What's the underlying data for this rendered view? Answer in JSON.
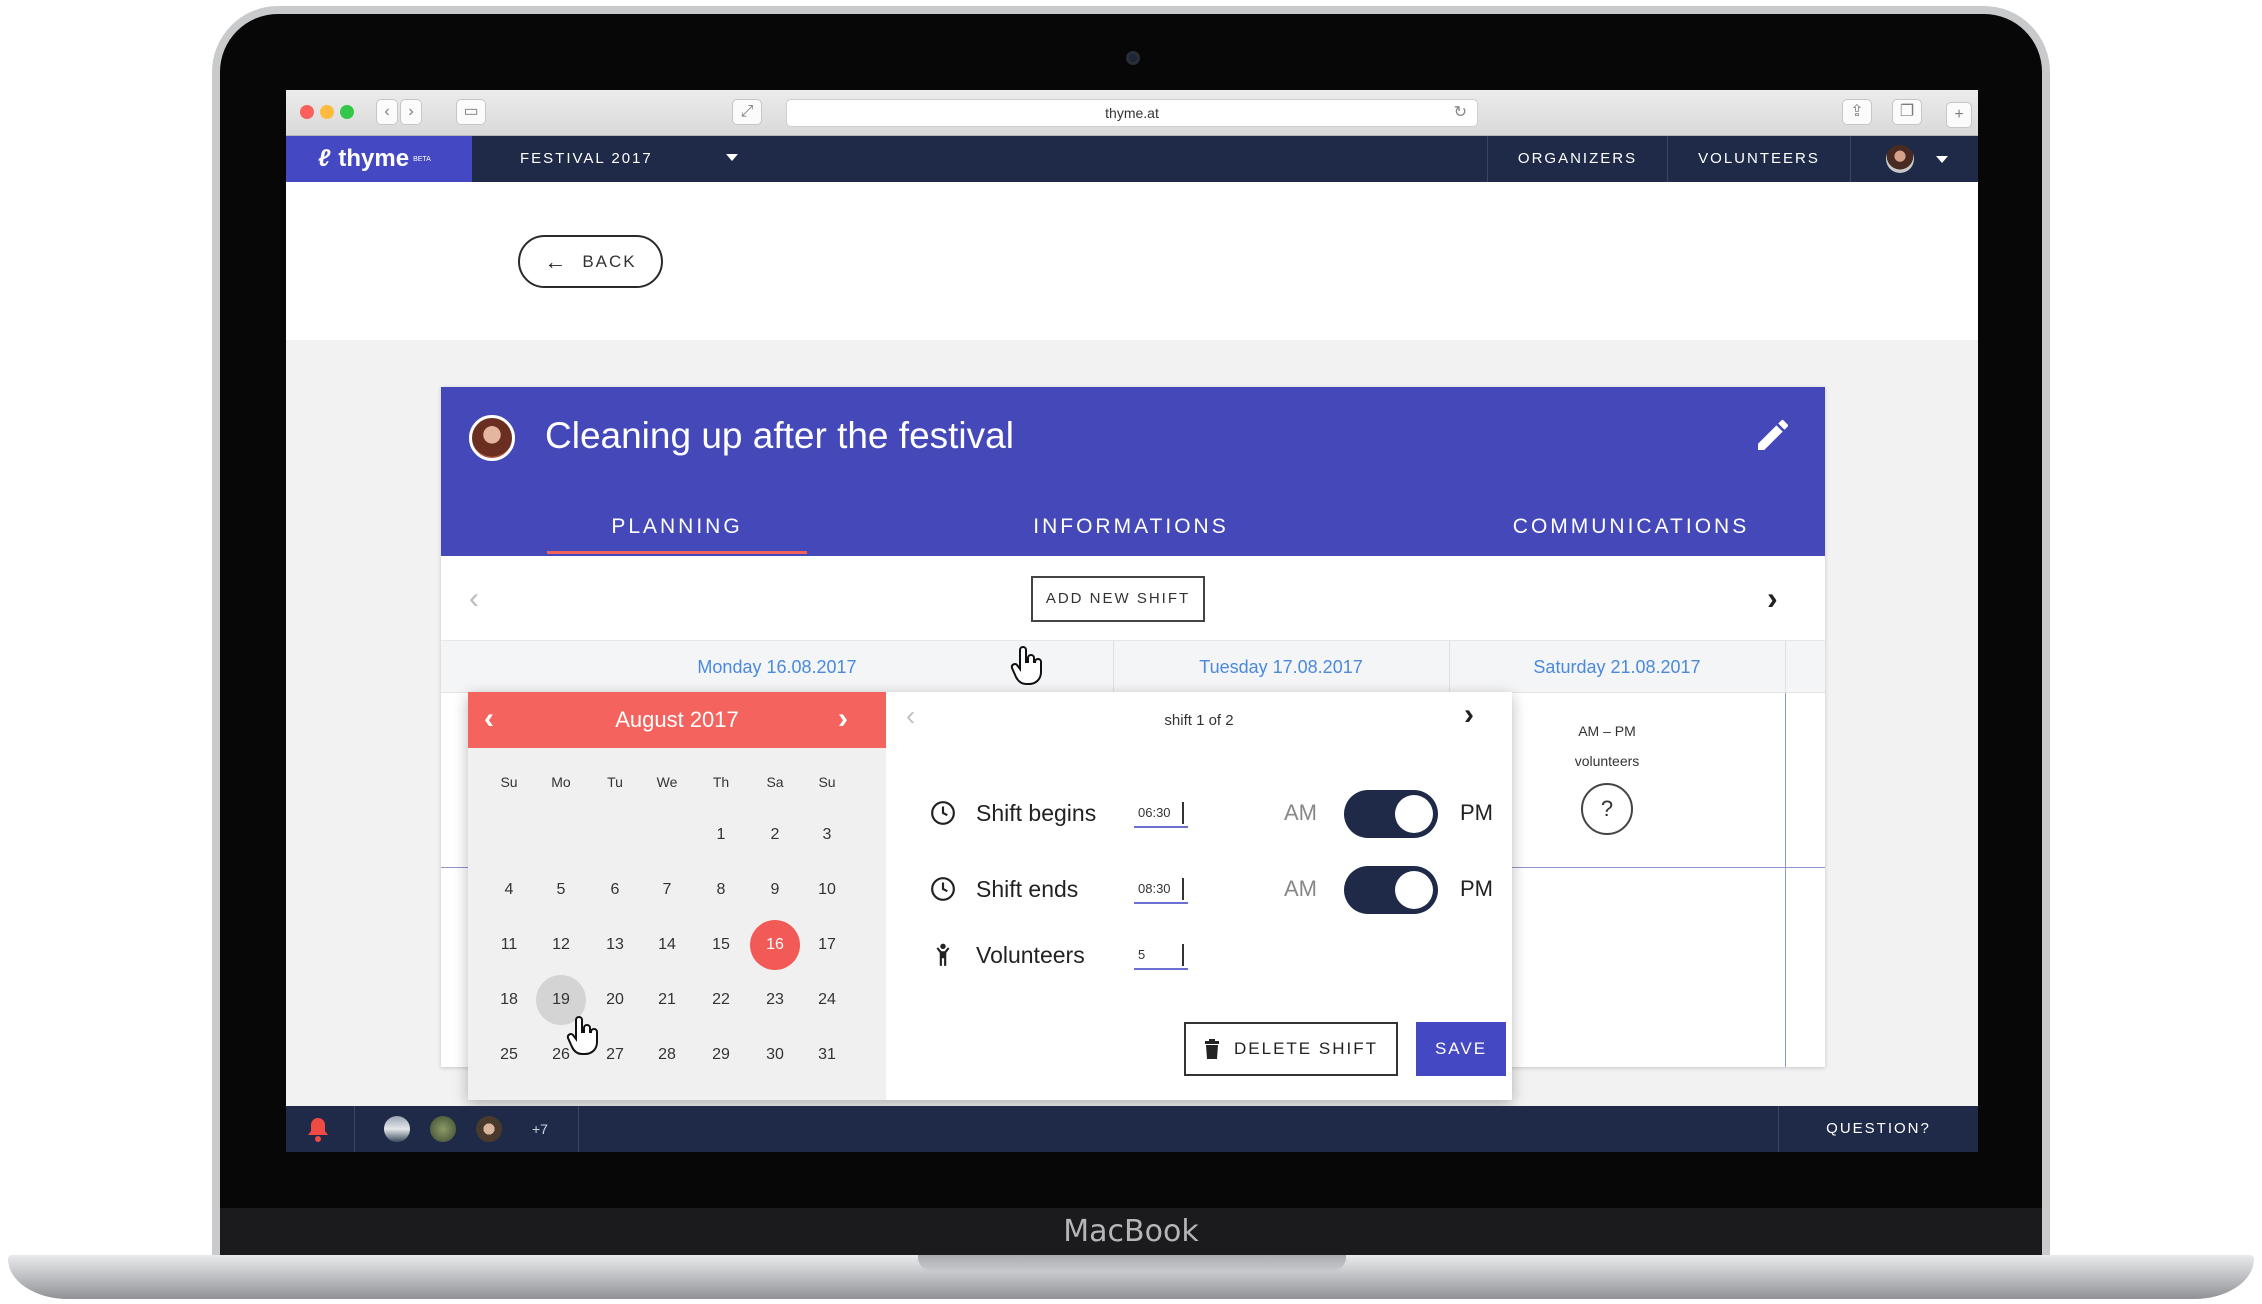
{
  "device": {
    "label": "MacBook"
  },
  "browser": {
    "url": "thyme.at"
  },
  "appnav": {
    "logo": "thyme",
    "logo_badge": "BETA",
    "event": "FESTIVAL 2017",
    "links": [
      "ORGANIZERS",
      "VOLUNTEERS"
    ]
  },
  "page": {
    "back_label": "BACK"
  },
  "card": {
    "title": "Cleaning up after the festival",
    "tabs": [
      "PLANNING",
      "INFORMATIONS",
      "COMMUNICATIONS"
    ],
    "active_tab": "PLANNING",
    "add_shift_label": "ADD NEW SHIFT",
    "days": [
      "Monday 16.08.2017",
      "Tuesday 17.08.2017",
      "Saturday 21.08.2017"
    ],
    "cell": {
      "range": "AM – PM",
      "label": "volunteers",
      "count": "?"
    }
  },
  "calendar": {
    "title": "August 2017",
    "weekdays": [
      "Su",
      "Mo",
      "Tu",
      "We",
      "Th",
      "Sa",
      "Su"
    ],
    "weeks": [
      [
        "",
        "",
        "",
        "",
        "1",
        "2",
        "3"
      ],
      [
        "4",
        "5",
        "6",
        "7",
        "8",
        "9",
        "10"
      ],
      [
        "11",
        "12",
        "13",
        "14",
        "15",
        "16",
        "17"
      ],
      [
        "18",
        "19",
        "20",
        "21",
        "22",
        "23",
        "24"
      ],
      [
        "25",
        "26",
        "27",
        "28",
        "29",
        "30",
        "31"
      ]
    ],
    "selected": "16",
    "hovered": "19"
  },
  "shift": {
    "counter": "shift 1 of 2",
    "begins_label": "Shift begins",
    "begins_value": "06:30",
    "ends_label": "Shift ends",
    "ends_value": "08:30",
    "volunteers_label": "Volunteers",
    "volunteers_value": "5",
    "am": "AM",
    "pm": "PM",
    "begins_period": "PM",
    "ends_period": "PM",
    "delete_label": "DELETE SHIFT",
    "save_label": "SAVE"
  },
  "bottombar": {
    "more_count": "+7",
    "question_label": "QUESTION?"
  },
  "colors": {
    "brand": "#4448c3",
    "navy": "#1e2a47",
    "accent": "#f4635e",
    "date_blue": "#4a89dc"
  }
}
